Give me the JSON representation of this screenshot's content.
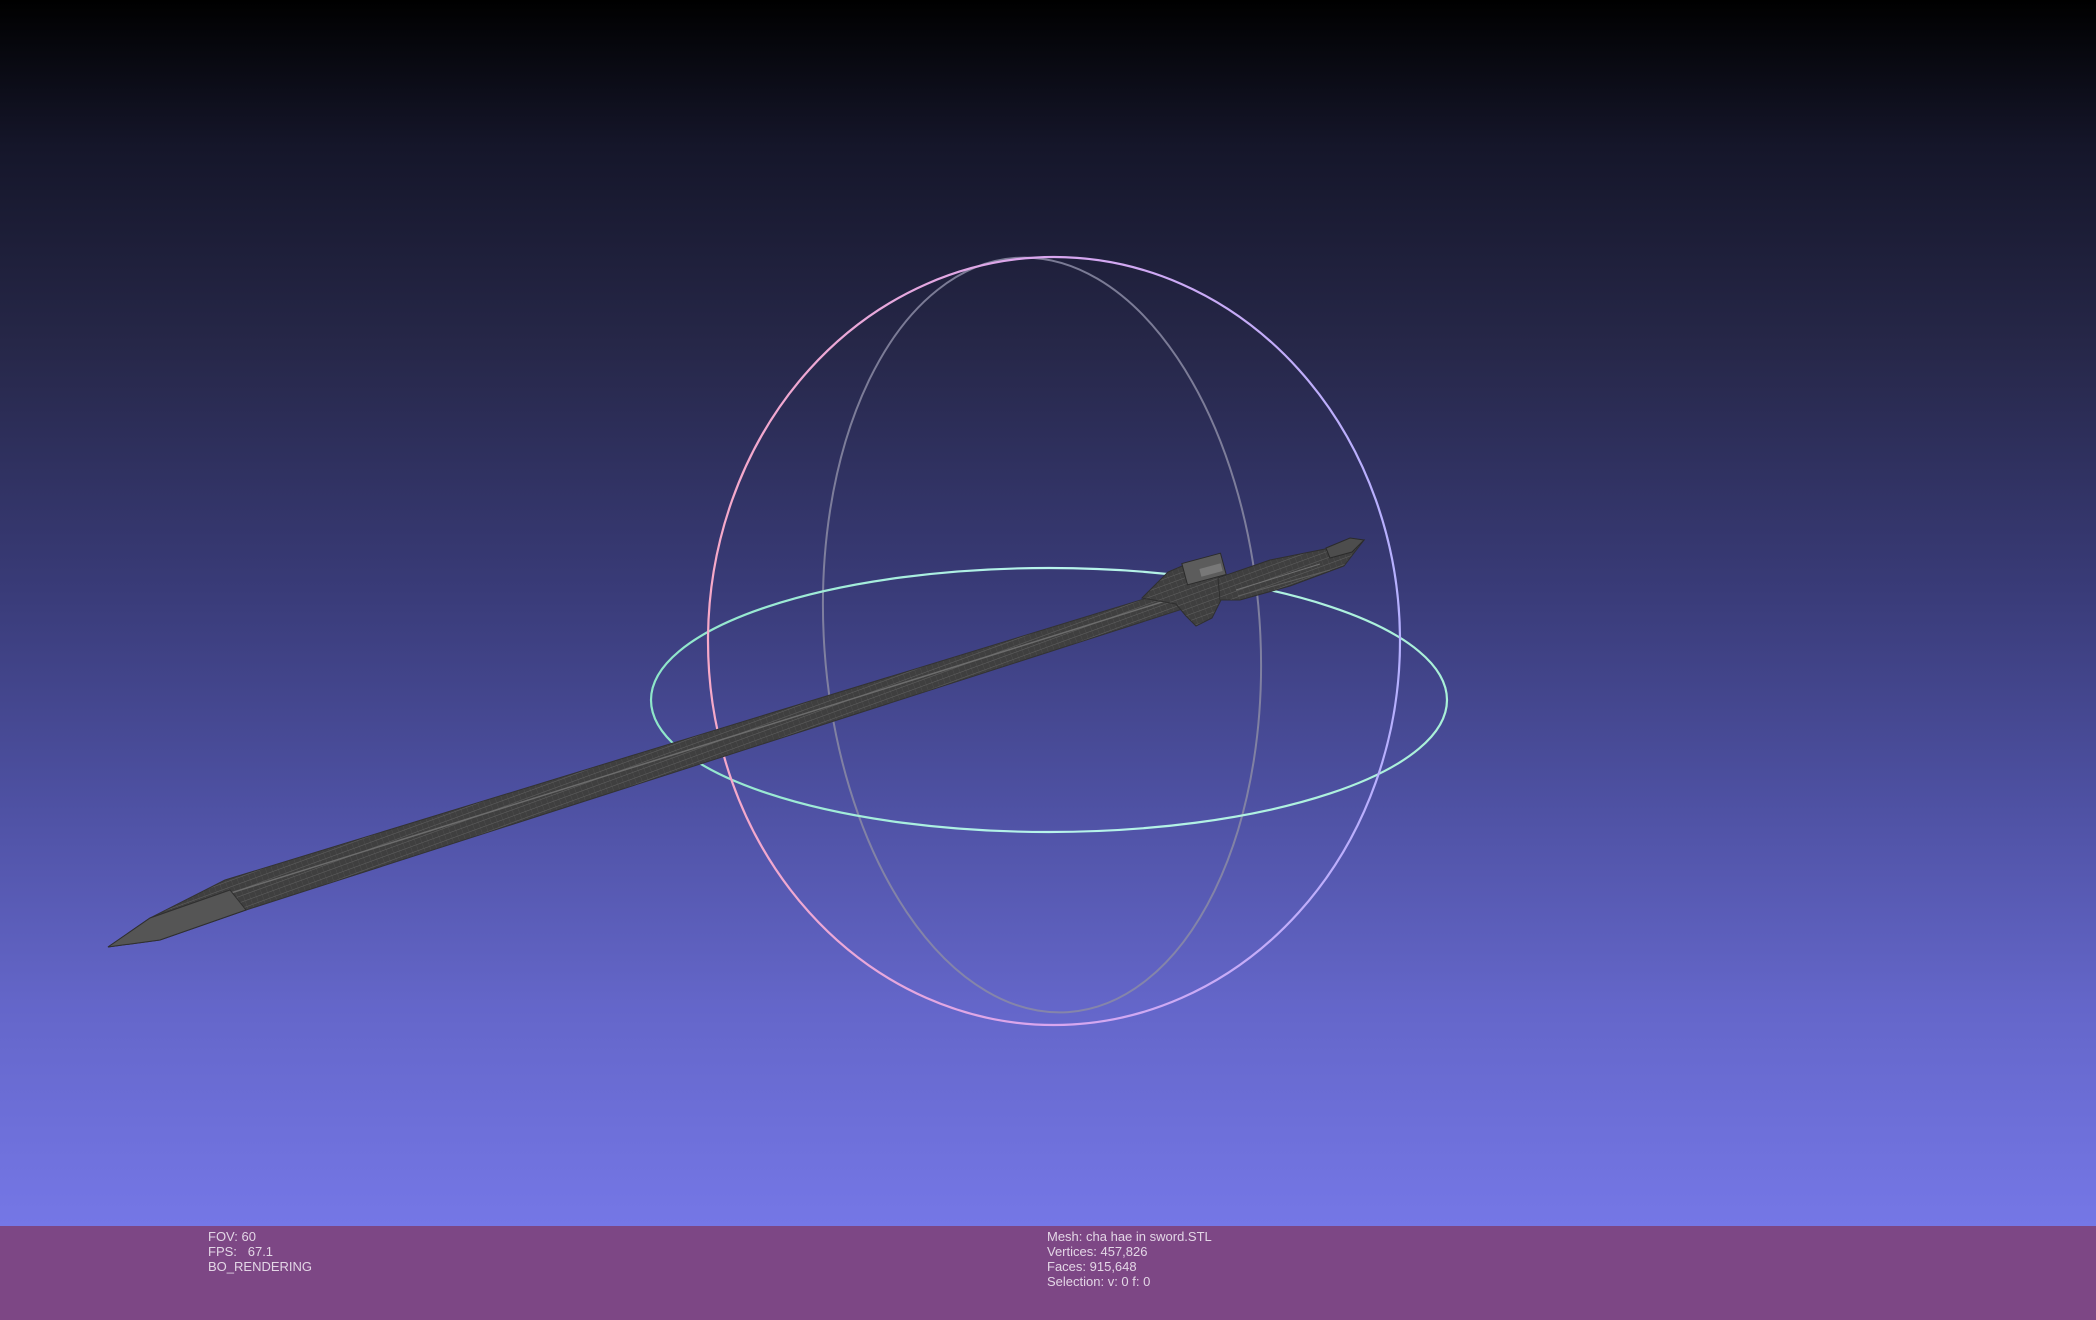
{
  "viewport": {
    "background_top": "#000000",
    "background_bottom": "#7577e6",
    "mesh_color": "#4a4a4a",
    "trackball_colors": {
      "horizontal_ring": "#9ff0dd",
      "vertical_ring_front": "#f2a6c8",
      "vertical_ring_side": "#b7a6f2",
      "back_ring": "#8a8aa8"
    }
  },
  "info_bar": {
    "background": "#7d4785",
    "left": {
      "fov": "FOV: 60",
      "fps": "FPS:   67.1",
      "rendering_mode": "BO_RENDERING"
    },
    "right": {
      "mesh": "Mesh: cha hae in sword.STL",
      "vertices": "Vertices: 457,826",
      "faces": "Faces: 915,648",
      "selection": "Selection: v: 0 f: 0"
    }
  }
}
